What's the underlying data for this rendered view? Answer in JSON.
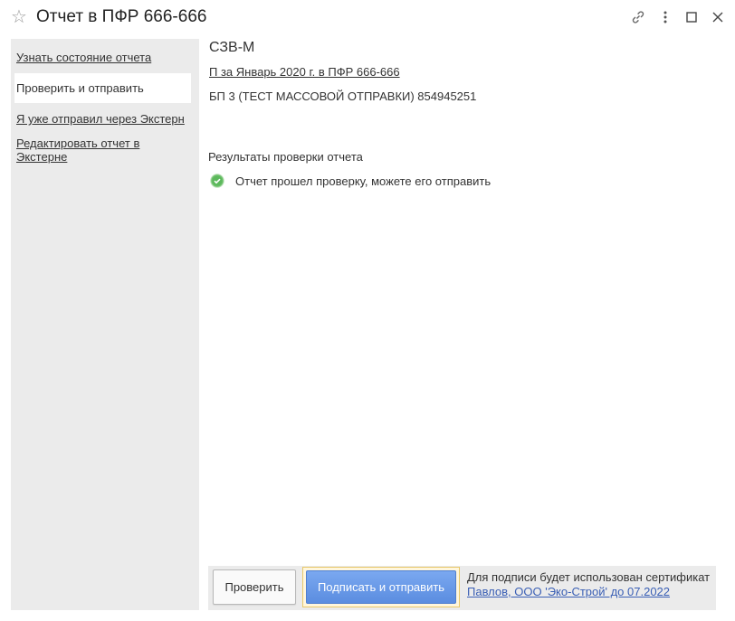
{
  "window": {
    "title": "Отчет в ПФР 666-666",
    "icons": [
      "star-icon",
      "link-icon",
      "more-vertical-icon",
      "maximize-icon",
      "close-icon"
    ]
  },
  "sidebar": {
    "items": [
      {
        "label": "Узнать состояние отчета",
        "type": "link"
      },
      {
        "label": "Проверить и отправить",
        "type": "active"
      },
      {
        "label": "Я уже отправил через Экстерн",
        "type": "link"
      },
      {
        "label": "Редактировать отчет в Экстерне",
        "type": "link"
      }
    ]
  },
  "report": {
    "type": "СЗВ-М",
    "period_link": "П за Январь 2020 г. в ПФР 666-666",
    "org_line": "БП 3 (ТЕСТ МАССОВОЙ ОТПРАВКИ) 854945251"
  },
  "results": {
    "title": "Результаты проверки отчета",
    "status_icon": "check-circle-icon",
    "status_color": "#5cb85c",
    "message": "Отчет прошел проверку, можете его отправить"
  },
  "footer": {
    "check_button": "Проверить",
    "send_button": "Подписать и отправить",
    "cert_text": "Для подписи будет использован сертификат",
    "cert_link": "Павлов, ООО 'Эко-Строй' до 07.2022"
  },
  "colors": {
    "sidebar_bg": "#ebebeb",
    "primary_button": "#5b8de0",
    "focus_frame": "#e8c86a",
    "link": "#3a5fb5"
  }
}
